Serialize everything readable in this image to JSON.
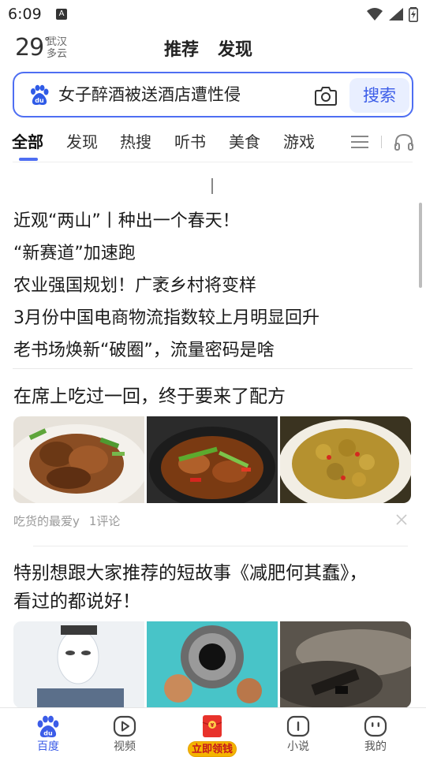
{
  "status_bar": {
    "time": "6:09",
    "badge": "A"
  },
  "weather": {
    "temp": "29",
    "degree": "°",
    "city": "武汉",
    "condition": "多云"
  },
  "top_tabs": [
    "推荐",
    "发现"
  ],
  "search": {
    "query": "女子醉酒被送酒店遭性侵",
    "button": "搜索"
  },
  "category_tabs": [
    "全部",
    "发现",
    "热搜",
    "听书",
    "美食",
    "游戏"
  ],
  "hot_news": [
    "近观“两山”丨种出一个春天！",
    "“新赛道”加速跑",
    "农业强国规划！广袤乡村将变样",
    "3月份中国电商物流指数较上月明显回升",
    "老书场焕新“破圈”，流量密码是啥"
  ],
  "articles": [
    {
      "title": "在席上吃过一回，终于要来了配方",
      "author": "吃货的最爱y",
      "comments": "1评论"
    },
    {
      "title": "特别想跟大家推荐的短故事《减肥何其蠢》，看过的都说好！"
    }
  ],
  "bottom_nav": [
    {
      "label": "百度",
      "icon": "baidu-paw-icon"
    },
    {
      "label": "视频",
      "icon": "play-icon"
    },
    {
      "label": "立即领钱",
      "icon": "red-packet-icon"
    },
    {
      "label": "小说",
      "icon": "book-icon"
    },
    {
      "label": "我的",
      "icon": "face-icon"
    }
  ],
  "colors": {
    "accent": "#4e6ef2",
    "search_button_bg": "#e9efff",
    "red_packet": "#e8322b"
  }
}
